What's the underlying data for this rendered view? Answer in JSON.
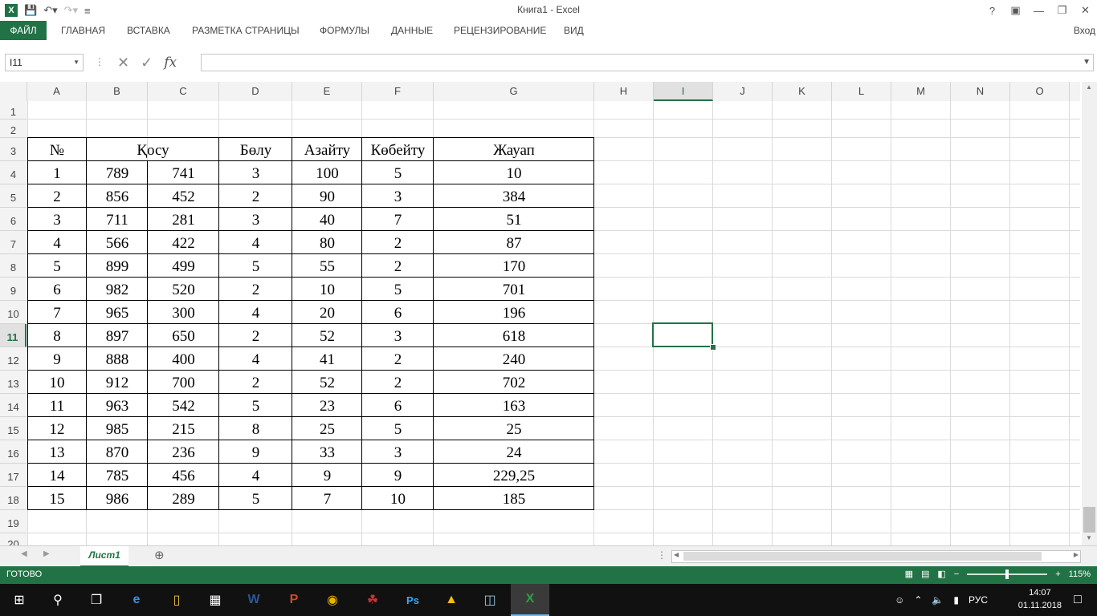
{
  "window": {
    "title": "Книга1 - Excel",
    "help": "?",
    "sign_in": "Вход"
  },
  "ribbon_tabs": [
    "ФАЙЛ",
    "ГЛАВНАЯ",
    "ВСТАВКА",
    "РАЗМЕТКА СТРАНИЦЫ",
    "ФОРМУЛЫ",
    "ДАННЫЕ",
    "РЕЦЕНЗИРОВАНИЕ",
    "ВИД"
  ],
  "formula_bar": {
    "name_box": "I11",
    "fx_label": "fx",
    "formula_value": ""
  },
  "columns": [
    "A",
    "B",
    "C",
    "D",
    "E",
    "F",
    "G",
    "H",
    "I",
    "J",
    "K",
    "L",
    "M",
    "N",
    "O"
  ],
  "selected_column": "I",
  "rows": [
    "1",
    "2",
    "3",
    "4",
    "5",
    "6",
    "7",
    "8",
    "9",
    "10",
    "11",
    "12",
    "13",
    "14",
    "15",
    "16",
    "17",
    "18",
    "19",
    "20"
  ],
  "selected_row": "11",
  "selected_cell": "I11",
  "table": {
    "headers": [
      "№",
      "Қосу",
      "Бөлу",
      "Азайту",
      "Көбейту",
      "Жауап"
    ],
    "rows": [
      [
        "1",
        "789",
        "741",
        "3",
        "100",
        "5",
        "10"
      ],
      [
        "2",
        "856",
        "452",
        "2",
        "90",
        "3",
        "384"
      ],
      [
        "3",
        "711",
        "281",
        "3",
        "40",
        "7",
        "51"
      ],
      [
        "4",
        "566",
        "422",
        "4",
        "80",
        "2",
        "87"
      ],
      [
        "5",
        "899",
        "499",
        "5",
        "55",
        "2",
        "170"
      ],
      [
        "6",
        "982",
        "520",
        "2",
        "10",
        "5",
        "701"
      ],
      [
        "7",
        "965",
        "300",
        "4",
        "20",
        "6",
        "196"
      ],
      [
        "8",
        "897",
        "650",
        "2",
        "52",
        "3",
        "618"
      ],
      [
        "9",
        "888",
        "400",
        "4",
        "41",
        "2",
        "240"
      ],
      [
        "10",
        "912",
        "700",
        "2",
        "52",
        "2",
        "702"
      ],
      [
        "11",
        "963",
        "542",
        "5",
        "23",
        "6",
        "163"
      ],
      [
        "12",
        "985",
        "215",
        "8",
        "25",
        "5",
        "25"
      ],
      [
        "13",
        "870",
        "236",
        "9",
        "33",
        "3",
        "24"
      ],
      [
        "14",
        "785",
        "456",
        "4",
        "9",
        "9",
        "229,25"
      ],
      [
        "15",
        "986",
        "289",
        "5",
        "7",
        "10",
        "185"
      ]
    ]
  },
  "sheet_tabs": [
    "Лист1"
  ],
  "status": {
    "ready": "ГОТОВО",
    "zoom": "115%",
    "zoom_level_fraction": 0.5
  },
  "taskbar": {
    "language": "РУС",
    "time": "14:07",
    "date": "01.11.2018",
    "apps": [
      "windows-start",
      "search",
      "task-view",
      "edge",
      "file-explorer",
      "calculator",
      "word",
      "powerpoint",
      "chrome",
      "paint",
      "photoshop",
      "app-triangle",
      "app-note",
      "excel"
    ]
  },
  "colors": {
    "excel_green": "#217346",
    "taskbar_bg": "#111111"
  }
}
